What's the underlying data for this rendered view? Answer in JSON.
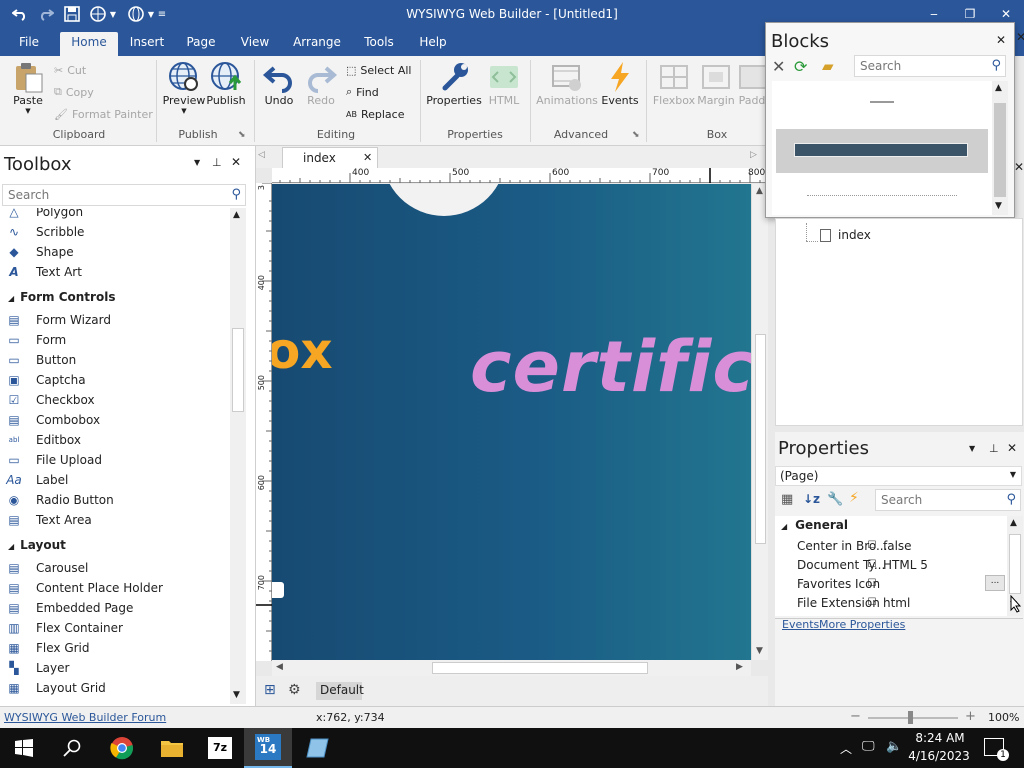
{
  "app": {
    "title": "WYSIWYG Web Builder - [Untitled1]"
  },
  "window_controls": {
    "minimize": "‒",
    "maximize": "❐",
    "close": "✕"
  },
  "menu": {
    "tabs": [
      "File",
      "Home",
      "Insert",
      "Page",
      "View",
      "Arrange",
      "Tools",
      "Help"
    ],
    "active": "Home"
  },
  "ribbon": {
    "clipboard": {
      "paste": "Paste",
      "cut": "Cut",
      "copy": "Copy",
      "format_painter": "Format Painter",
      "group": "Clipboard"
    },
    "publish": {
      "preview": "Preview",
      "publish": "Publish",
      "group": "Publish"
    },
    "editing": {
      "undo": "Undo",
      "redo": "Redo",
      "select_all": "Select All",
      "find": "Find",
      "replace": "Replace",
      "group": "Editing"
    },
    "properties": {
      "properties": "Properties",
      "html": "HTML",
      "group": "Properties"
    },
    "advanced": {
      "animations": "Animations",
      "events": "Events",
      "group": "Advanced"
    },
    "box": {
      "flexbox": "Flexbox",
      "margin": "Margin",
      "padding": "Padd",
      "group": "Box"
    }
  },
  "toolbox": {
    "title": "Toolbox",
    "search_placeholder": "Search",
    "items_top": [
      {
        "label": "Polygon",
        "icon": "polygon-icon"
      },
      {
        "label": "Scribble",
        "icon": "scribble-icon"
      },
      {
        "label": "Shape",
        "icon": "shape-icon"
      },
      {
        "label": "Text Art",
        "icon": "text-art-icon"
      }
    ],
    "section_form": "Form Controls",
    "form_items": [
      {
        "label": "Form Wizard",
        "icon": "form-wizard-icon"
      },
      {
        "label": "Form",
        "icon": "form-icon"
      },
      {
        "label": "Button",
        "icon": "button-icon"
      },
      {
        "label": "Captcha",
        "icon": "captcha-icon"
      },
      {
        "label": "Checkbox",
        "icon": "checkbox-icon"
      },
      {
        "label": "Combobox",
        "icon": "combobox-icon"
      },
      {
        "label": "Editbox",
        "icon": "editbox-icon"
      },
      {
        "label": "File Upload",
        "icon": "file-upload-icon"
      },
      {
        "label": "Label",
        "icon": "label-icon"
      },
      {
        "label": "Radio Button",
        "icon": "radio-button-icon"
      },
      {
        "label": "Text Area",
        "icon": "text-area-icon"
      }
    ],
    "section_layout": "Layout",
    "layout_items": [
      {
        "label": "Carousel",
        "icon": "carousel-icon"
      },
      {
        "label": "Content Place Holder",
        "icon": "content-placeholder-icon"
      },
      {
        "label": "Embedded Page",
        "icon": "embedded-page-icon"
      },
      {
        "label": "Flex Container",
        "icon": "flex-container-icon"
      },
      {
        "label": "Flex Grid",
        "icon": "flex-grid-icon"
      },
      {
        "label": "Layer",
        "icon": "layer-icon"
      },
      {
        "label": "Layout Grid",
        "icon": "layout-grid-icon"
      }
    ]
  },
  "document": {
    "tab": "index",
    "ruler_h": [
      "400",
      "500",
      "600",
      "700",
      "800"
    ],
    "ruler_v": [
      "3",
      "400",
      "500",
      "600",
      "700"
    ],
    "canvas_text_left": "ox",
    "canvas_text_main": "certifica",
    "page_default": "Default"
  },
  "status": {
    "forum_link": "WYSIWYG Web Builder Forum",
    "coords": "x:762, y:734",
    "zoom": "100%"
  },
  "blocks": {
    "title": "Blocks",
    "search_placeholder": "Search"
  },
  "site_tree": {
    "page": "index"
  },
  "properties": {
    "title": "Properties",
    "selector": "(Page)",
    "search_placeholder": "Search",
    "group": "General",
    "rows": [
      {
        "name": "Center in Bro...",
        "value": "false"
      },
      {
        "name": "Document Ty...",
        "value": "HTML 5"
      },
      {
        "name": "Favorites Icon",
        "value": ""
      },
      {
        "name": "File Extension",
        "value": "html"
      }
    ],
    "ellipsis": "...",
    "events_link": "Events",
    "more_link": "More Properties"
  },
  "taskbar": {
    "time": "8:24 AM",
    "date": "4/16/2023",
    "notification_count": "1",
    "wb_label": "14"
  },
  "colors": {
    "accent": "#2b579a",
    "canvas": "#1a5b85",
    "text_art_pink": "#d98fd8",
    "logo_orange": "#f6a623"
  }
}
